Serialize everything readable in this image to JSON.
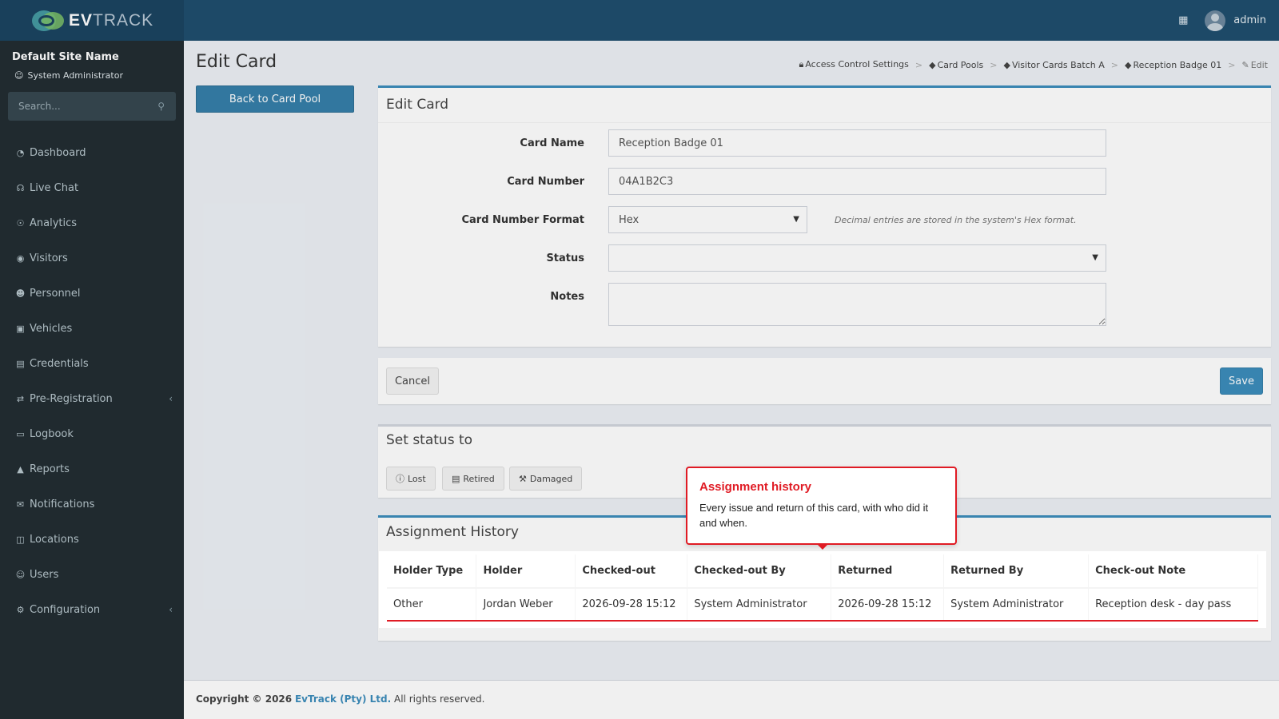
{
  "header": {
    "logo_bold": "EV",
    "logo_light": "TRACK",
    "user_name": "admin"
  },
  "sidebar": {
    "site_name": "Default Site Name",
    "role": "System Administrator",
    "search_placeholder": "Search...",
    "items": [
      {
        "label": "Dashboard",
        "icon": "dashboard-icon"
      },
      {
        "label": "Live Chat",
        "icon": "headset-icon"
      },
      {
        "label": "Analytics",
        "icon": "target-icon"
      },
      {
        "label": "Visitors",
        "icon": "eye-icon"
      },
      {
        "label": "Personnel",
        "icon": "users-icon"
      },
      {
        "label": "Vehicles",
        "icon": "car-icon"
      },
      {
        "label": "Credentials",
        "icon": "id-card-icon"
      },
      {
        "label": "Pre-Registration",
        "icon": "exchange-icon",
        "has_children": true
      },
      {
        "label": "Logbook",
        "icon": "book-icon"
      },
      {
        "label": "Reports",
        "icon": "chart-icon"
      },
      {
        "label": "Notifications",
        "icon": "chat-icon"
      },
      {
        "label": "Locations",
        "icon": "map-icon"
      },
      {
        "label": "Users",
        "icon": "user-cog-icon"
      },
      {
        "label": "Configuration",
        "icon": "gear-icon",
        "has_children": true
      }
    ]
  },
  "page": {
    "title": "Edit Card",
    "back_button": "Back to Card Pool",
    "breadcrumb": [
      "Access Control Settings",
      "Card Pools",
      "Visitor Cards Batch A",
      "Reception Badge 01",
      "Edit"
    ]
  },
  "form": {
    "box_title": "Edit Card",
    "card_name_label": "Card Name",
    "card_name_value": "Reception Badge 01",
    "card_number_label": "Card Number",
    "card_number_value": "04A1B2C3",
    "format_label": "Card Number Format",
    "format_value": "Hex",
    "format_note": "Decimal entries are stored in the system's Hex format.",
    "status_label": "Status",
    "status_value": "",
    "notes_label": "Notes",
    "notes_value": ""
  },
  "actions": {
    "cancel": "Cancel",
    "save": "Save"
  },
  "set_status": {
    "title": "Set status to",
    "buttons": [
      "Lost",
      "Retired",
      "Damaged"
    ]
  },
  "history": {
    "title": "Assignment History",
    "columns": [
      "Holder Type",
      "Holder",
      "Checked-out",
      "Checked-out By",
      "Returned",
      "Returned By",
      "Check-out Note"
    ],
    "rows": [
      [
        "Other",
        "Jordan Weber",
        "2026-09-28 15:12",
        "System Administrator",
        "2026-09-28 15:12",
        "System Administrator",
        "Reception desk - day pass"
      ]
    ]
  },
  "tooltip": {
    "title": "Assignment history",
    "body": "Every issue and return of this card, with who did it and when."
  },
  "footer": {
    "prefix": "Copyright © 2026",
    "company": "EvTrack (Pty) Ltd.",
    "suffix": "All rights reserved."
  }
}
